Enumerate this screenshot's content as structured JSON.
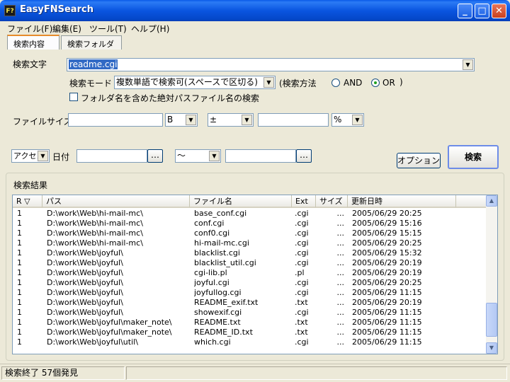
{
  "window": {
    "title": "EasyFNSearch",
    "icon_text": "F?",
    "minimize": "_",
    "maximize": "□",
    "close": "✕"
  },
  "menu": [
    "ファイル(F)",
    "編集(E)",
    "ツール(T)",
    "ヘルプ(H)"
  ],
  "tabs": [
    "検索内容",
    "検索フォルダ"
  ],
  "search": {
    "label": "検索文字",
    "value": "readme.cgi",
    "mode_label": "検索モード",
    "mode_value": "複数単語で検索可(スペースで区切る)",
    "method_label": "(検索方法",
    "method_and": "AND",
    "method_or": "OR",
    "method_close": ")",
    "fullpath_label": "フォルダ名を含めた絶対パスファイル名の検索"
  },
  "filesize": {
    "label": "ファイルサイズ",
    "unit": "B",
    "op": "±",
    "pct": "%"
  },
  "date": {
    "type": "アクセス",
    "label": "日付",
    "range": "～",
    "ellipsis": "…"
  },
  "buttons": {
    "options": "オプション",
    "search": "検索"
  },
  "results": {
    "title": "検索結果",
    "columns": [
      "R ▽",
      "パス",
      "ファイル名",
      "Ext",
      "サイズ",
      "更新日時"
    ],
    "rows": [
      [
        "1",
        "D:\\work\\Web\\hi-mail-mc\\",
        "base_conf.cgi",
        ".cgi",
        "...",
        "2005/06/29 20:25"
      ],
      [
        "1",
        "D:\\work\\Web\\hi-mail-mc\\",
        "conf.cgi",
        ".cgi",
        "...",
        "2005/06/29 15:16"
      ],
      [
        "1",
        "D:\\work\\Web\\hi-mail-mc\\",
        "conf0.cgi",
        ".cgi",
        "...",
        "2005/06/29 15:15"
      ],
      [
        "1",
        "D:\\work\\Web\\hi-mail-mc\\",
        "hi-mail-mc.cgi",
        ".cgi",
        "...",
        "2005/06/29 20:25"
      ],
      [
        "1",
        "D:\\work\\Web\\joyful\\",
        "blacklist.cgi",
        ".cgi",
        "...",
        "2005/06/29 15:32"
      ],
      [
        "1",
        "D:\\work\\Web\\joyful\\",
        "blacklist_util.cgi",
        ".cgi",
        "...",
        "2005/06/29 20:19"
      ],
      [
        "1",
        "D:\\work\\Web\\joyful\\",
        "cgi-lib.pl",
        ".pl",
        "...",
        "2005/06/29 20:19"
      ],
      [
        "1",
        "D:\\work\\Web\\joyful\\",
        "joyful.cgi",
        ".cgi",
        "...",
        "2005/06/29 20:25"
      ],
      [
        "1",
        "D:\\work\\Web\\joyful\\",
        "joyfullog.cgi",
        ".cgi",
        "...",
        "2005/06/29 11:15"
      ],
      [
        "1",
        "D:\\work\\Web\\joyful\\",
        "README_exif.txt",
        ".txt",
        "...",
        "2005/06/29 20:19"
      ],
      [
        "1",
        "D:\\work\\Web\\joyful\\",
        "showexif.cgi",
        ".cgi",
        "...",
        "2005/06/29 11:15"
      ],
      [
        "1",
        "D:\\work\\Web\\joyful\\maker_note\\",
        "README.txt",
        ".txt",
        "...",
        "2005/06/29 11:15"
      ],
      [
        "1",
        "D:\\work\\Web\\joyful\\maker_note\\",
        "README_ID.txt",
        ".txt",
        "...",
        "2005/06/29 11:15"
      ],
      [
        "1",
        "D:\\work\\Web\\joyful\\util\\",
        "which.cgi",
        ".cgi",
        "...",
        "2005/06/29 11:15"
      ]
    ]
  },
  "status": {
    "text": "検索終了 57個発見"
  },
  "colors": {
    "titlebar": "#0a55e0",
    "selection": "#316ac5"
  }
}
